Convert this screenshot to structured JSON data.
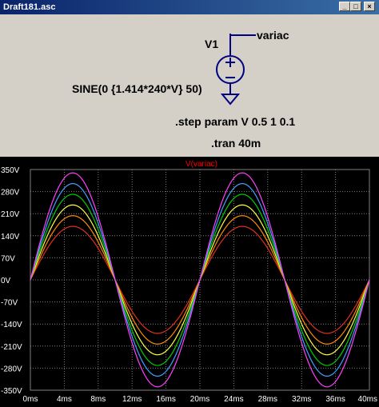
{
  "window": {
    "title": "Draft181.asc"
  },
  "schematic": {
    "source_name": "V1",
    "net_label": "variac",
    "source_value": "SINE(0 {1.414*240*V} 50)",
    "step_directive": ".step param V 0.5 1 0.1",
    "tran_directive": ".tran 40m"
  },
  "plot": {
    "trace_label": "V(variac)",
    "trace_label_color": "#ff0000"
  },
  "chart_data": {
    "type": "line",
    "title": "V(variac)",
    "xlabel": "",
    "ylabel": "",
    "xlim": [
      0,
      40
    ],
    "ylim": [
      -350,
      350
    ],
    "x_unit": "ms",
    "y_unit": "V",
    "grid": true,
    "x_ticks": [
      "0ms",
      "4ms",
      "8ms",
      "12ms",
      "16ms",
      "20ms",
      "24ms",
      "28ms",
      "32ms",
      "36ms",
      "40ms"
    ],
    "y_ticks": [
      "350V",
      "280V",
      "210V",
      "140V",
      "70V",
      "0V",
      "-70V",
      "-140V",
      "-210V",
      "-280V",
      "-350V"
    ],
    "x_tick_values": [
      0,
      4,
      8,
      12,
      16,
      20,
      24,
      28,
      32,
      36,
      40
    ],
    "y_tick_values": [
      350,
      280,
      210,
      140,
      70,
      0,
      -70,
      -140,
      -210,
      -280,
      -350
    ],
    "frequency_hz": 50,
    "series": [
      {
        "amplitude": 169.7,
        "color": "#e03020"
      },
      {
        "amplitude": 203.6,
        "color": "#ff8c00"
      },
      {
        "amplitude": 237.6,
        "color": "#ffff40"
      },
      {
        "amplitude": 271.5,
        "color": "#00d000"
      },
      {
        "amplitude": 305.4,
        "color": "#40a0ff"
      },
      {
        "amplitude": 339.4,
        "color": "#ff40ff"
      }
    ]
  }
}
